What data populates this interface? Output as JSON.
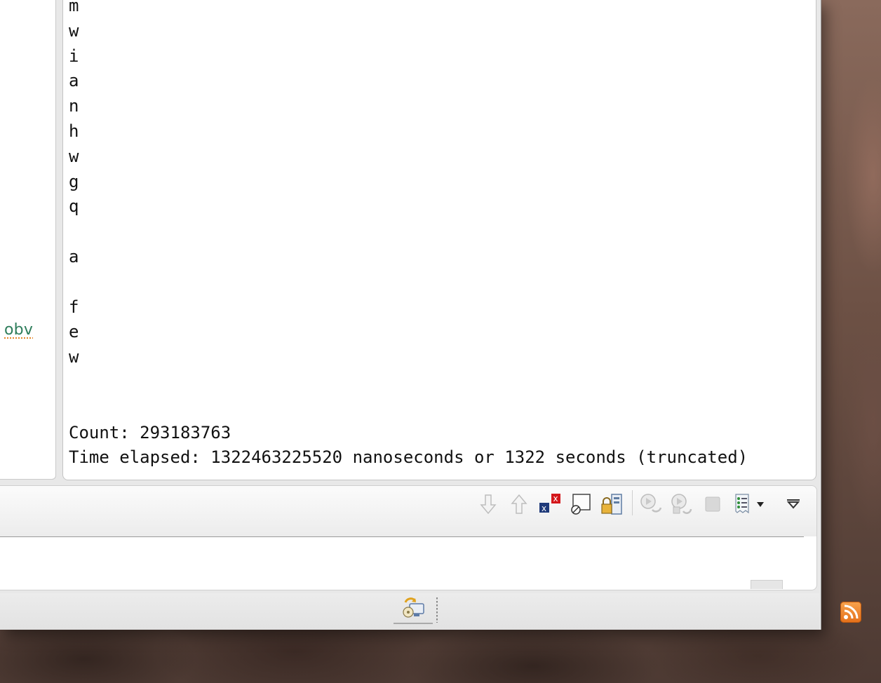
{
  "left_panel": {
    "snippet": "obv"
  },
  "console": {
    "lines": [
      "m",
      "w",
      "i",
      "a",
      "n",
      "h",
      "w",
      "g",
      "q",
      "",
      "a",
      "",
      "f",
      "e",
      "w",
      "",
      "",
      "Count: 293183763",
      "Time elapsed: 1322463225520 nanoseconds or 1322 seconds (truncated)"
    ]
  },
  "toolbar": {
    "icons": [
      "scroll-down-icon",
      "scroll-up-icon",
      "remove-all-terminated-icon",
      "clear-console-icon",
      "pin-console-icon",
      "open-console-icon",
      "terminate-relaunch-icon",
      "remove-launch-icon",
      "terminate-icon",
      "display-selected-console-icon",
      "view-menu-icon"
    ]
  },
  "status_bar": {
    "icons": [
      "remote-system-icon",
      "rss-feed-icon"
    ]
  },
  "colors": {
    "accent_green": "#2e7d5b",
    "spell_underline": "#e58a2d",
    "rss": "#e5701a"
  }
}
